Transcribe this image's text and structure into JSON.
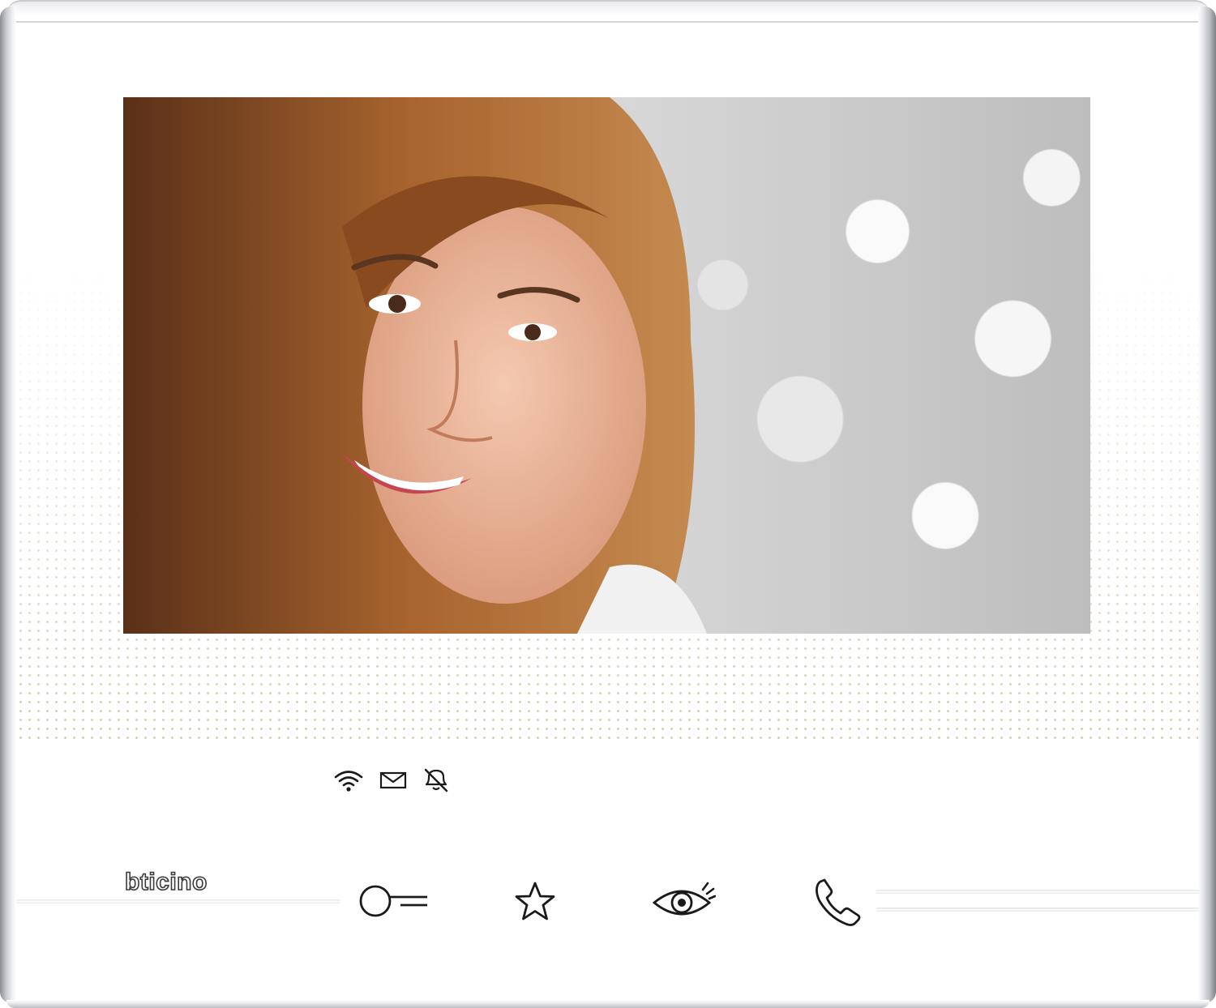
{
  "device": {
    "brand_logo": "bticino",
    "screen_image": "video-call-visitor-portrait",
    "status_icons": [
      {
        "name": "wifi-icon"
      },
      {
        "name": "envelope-icon"
      },
      {
        "name": "bell-muted-icon"
      }
    ],
    "buttons": [
      {
        "name": "door-lock-key-icon",
        "action": "door-unlock"
      },
      {
        "name": "star-icon",
        "action": "favorites"
      },
      {
        "name": "eye-icon",
        "action": "camera-view"
      },
      {
        "name": "phone-handset-icon",
        "action": "answer-call"
      }
    ],
    "colors": {
      "body": "#ffffff",
      "dot_pattern": "#d6c7ac",
      "icon": "#1a1a1a",
      "frame_metal": "#9a9da2"
    }
  }
}
